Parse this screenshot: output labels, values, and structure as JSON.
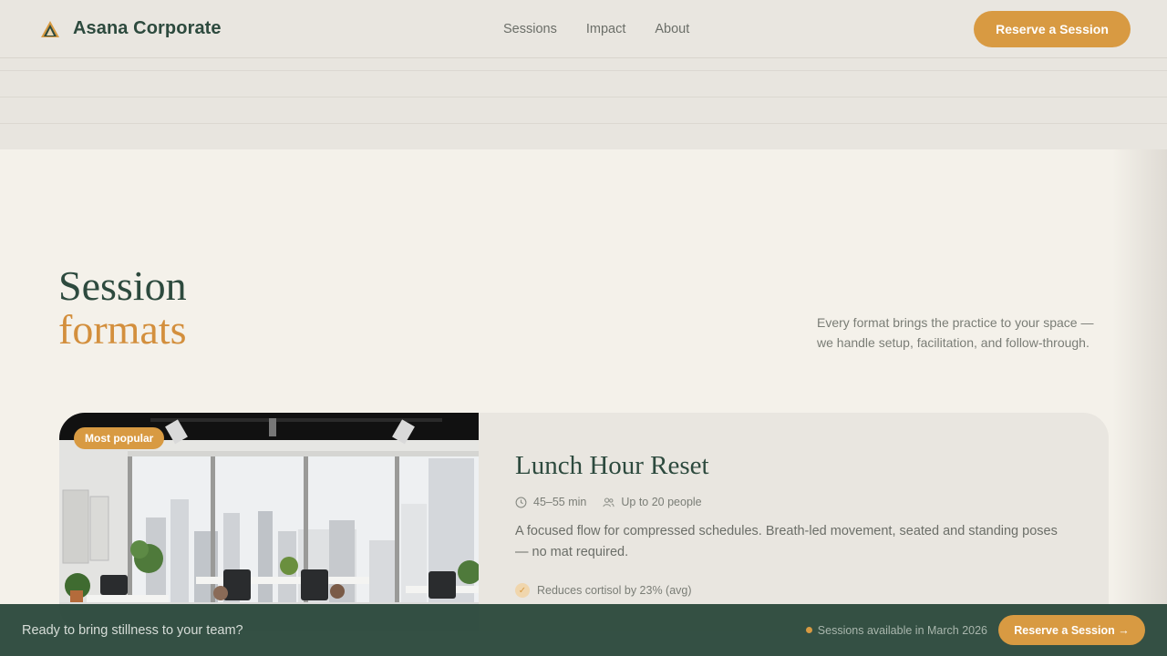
{
  "header": {
    "brand_name": "Asana Corporate",
    "logo_icon": "mountain-triangle-icon",
    "nav": [
      {
        "label": "Sessions"
      },
      {
        "label": "Impact"
      },
      {
        "label": "About"
      }
    ],
    "cta_label": "Reserve a Session"
  },
  "section": {
    "title_line1": "Session",
    "title_line2": "formats",
    "description": "Every format brings the practice to your space — we handle setup, facilitation, and follow-through."
  },
  "card": {
    "badge": "Most popular",
    "title": "Lunch Hour Reset",
    "duration": "45–55 min",
    "capacity": "Up to 20 people",
    "description": "A focused flow for compressed schedules. Breath-led movement, seated and standing poses — no mat required.",
    "benefit": "Reduces cortisol by 23% (avg)"
  },
  "bottom_bar": {
    "text": "Ready to bring stillness to your team?",
    "availability": "Sessions available in March 2026",
    "cta_label": "Reserve a Session →"
  },
  "colors": {
    "brand_green": "#2d4a3e",
    "accent_orange": "#d89a42",
    "background": "#f4f1ea"
  }
}
